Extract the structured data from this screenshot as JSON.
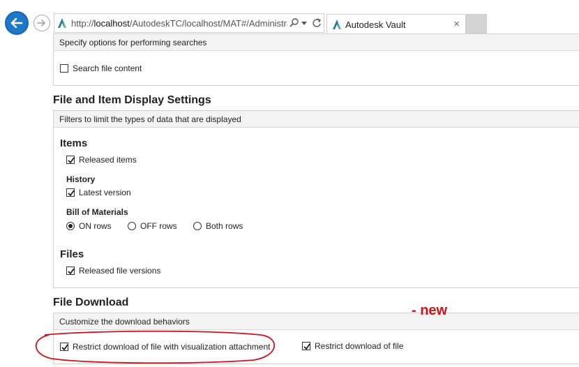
{
  "browser": {
    "url_prefix": "http://",
    "url_host": "localhost",
    "url_rest": "/AutodeskTC/localhost/MAT#/Administrat",
    "tab_title": "Autodesk Vault",
    "tab_close": "×"
  },
  "search_panel": {
    "header": "Specify options for performing searches",
    "search_file_content": {
      "label": "Search file content",
      "checked": false
    }
  },
  "display_settings": {
    "title": "File and Item Display Settings",
    "header": "Filters to limit the types of data that are displayed",
    "items_heading": "Items",
    "released_items": {
      "label": "Released items",
      "checked": true
    },
    "history_heading": "History",
    "latest_version": {
      "label": "Latest version",
      "checked": true
    },
    "bom_heading": "Bill of Materials",
    "bom_options": [
      {
        "label": "ON rows",
        "selected": true
      },
      {
        "label": "OFF rows",
        "selected": false
      },
      {
        "label": "Both rows",
        "selected": false
      }
    ],
    "files_heading": "Files",
    "released_file_versions": {
      "label": "Released file versions",
      "checked": true
    }
  },
  "file_download": {
    "title": "File Download",
    "header": "Customize the download behaviors",
    "restrict_visualization": {
      "label": "Restrict download of file with visualization attachment",
      "checked": true
    },
    "restrict_file": {
      "label": "Restrict download of file",
      "checked": true
    }
  },
  "annotation": {
    "new_label": "- new",
    "highlight_color": "#d0121b"
  },
  "icons": [
    "back-arrow-icon",
    "forward-arrow-icon",
    "autodesk-logo-icon",
    "search-icon",
    "dropdown-icon",
    "refresh-icon",
    "close-icon",
    "checkmark-icon"
  ]
}
